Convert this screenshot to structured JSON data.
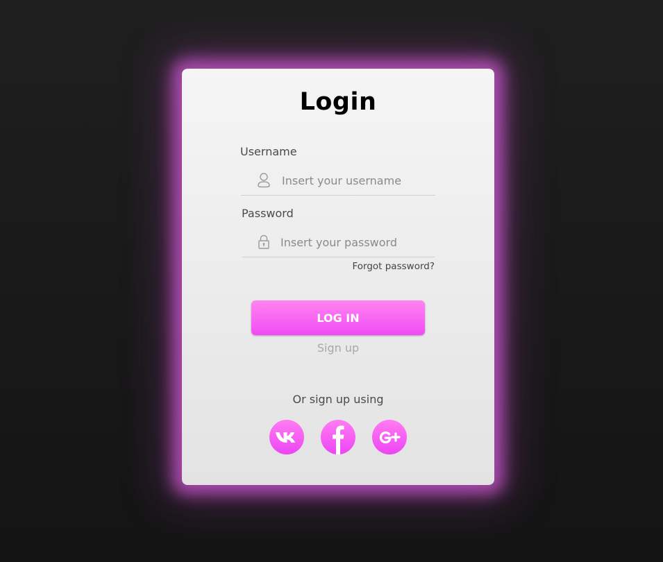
{
  "login": {
    "title": "Login",
    "username": {
      "label": "Username",
      "placeholder": "Insert your username",
      "icon": "user-icon"
    },
    "password": {
      "label": "Password",
      "placeholder": "Insert your password",
      "icon": "lock-icon"
    },
    "forgot_label": "Forgot password?",
    "login_button_label": "LOG IN",
    "signup_label": "Sign up",
    "social": {
      "caption": "Or sign up using",
      "items": [
        {
          "name": "vk",
          "icon": "vk-icon"
        },
        {
          "name": "facebook",
          "icon": "facebook-icon"
        },
        {
          "name": "google-plus",
          "icon": "google-plus-icon"
        }
      ]
    }
  },
  "colors": {
    "accent": "#f04cf5",
    "accent_light": "#ff85f0",
    "glow": "#d05ad2",
    "page_background": "#1a1a1a",
    "card_background": "#eeeeee",
    "muted_text": "#a8a8a8"
  }
}
